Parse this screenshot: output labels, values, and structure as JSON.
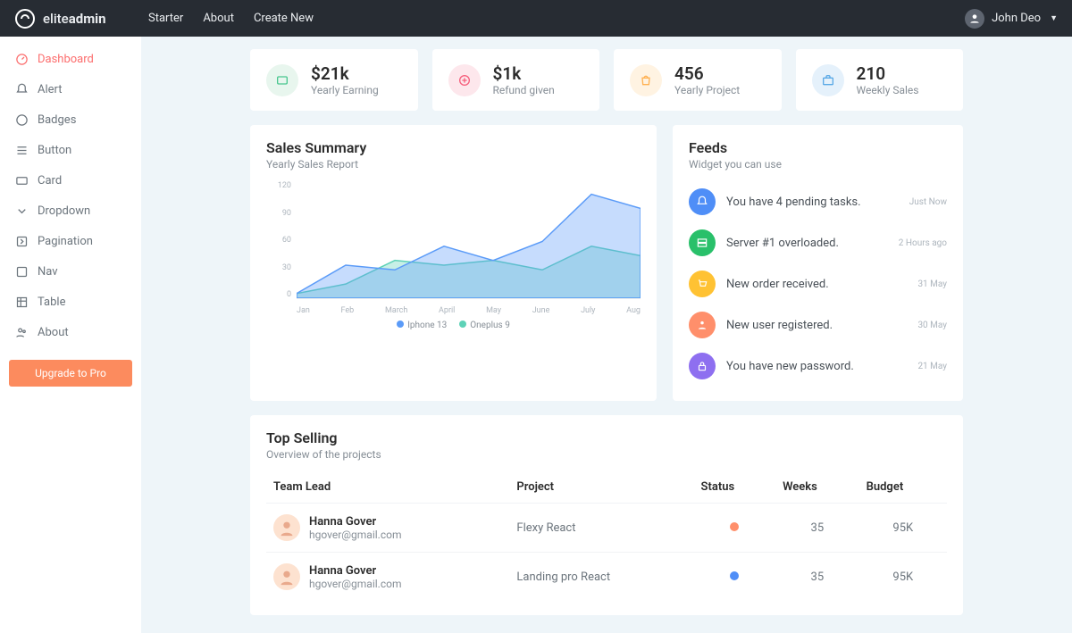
{
  "brand": {
    "pre": "elite",
    "bold": "admin"
  },
  "topnav": [
    "Starter",
    "About",
    "Create New"
  ],
  "user": {
    "name": "John Deo"
  },
  "sidebar": [
    {
      "label": "Dashboard",
      "icon": "dashboard-icon",
      "active": true
    },
    {
      "label": "Alert",
      "icon": "bell-icon"
    },
    {
      "label": "Badges",
      "icon": "tag-icon"
    },
    {
      "label": "Button",
      "icon": "list-icon"
    },
    {
      "label": "Card",
      "icon": "card-icon"
    },
    {
      "label": "Dropdown",
      "icon": "dropdown-icon"
    },
    {
      "label": "Pagination",
      "icon": "pagination-icon"
    },
    {
      "label": "Nav",
      "icon": "nav-icon"
    },
    {
      "label": "Table",
      "icon": "table-icon"
    },
    {
      "label": "About",
      "icon": "users-icon"
    }
  ],
  "upgrade_label": "Upgrade to Pro",
  "stats": [
    {
      "value": "$21k",
      "label": "Yearly Earning",
      "bg": "#e8f6ee",
      "fg": "#48c78e",
      "icon": "wallet-icon"
    },
    {
      "value": "$1k",
      "label": "Refund given",
      "bg": "#fde7ec",
      "fg": "#f65f7c",
      "icon": "refund-icon"
    },
    {
      "value": "456",
      "label": "Yearly Project",
      "bg": "#fff3e2",
      "fg": "#ffb152",
      "icon": "bag-icon"
    },
    {
      "value": "210",
      "label": "Weekly Sales",
      "bg": "#e5f1fb",
      "fg": "#5aa9e6",
      "icon": "briefcase-icon"
    }
  ],
  "sales": {
    "title": "Sales Summary",
    "subtitle": "Yearly Sales Report",
    "legend": [
      {
        "name": "Iphone 13",
        "color": "#5b9bf8"
      },
      {
        "name": "Oneplus 9",
        "color": "#5ed2b7"
      }
    ]
  },
  "chart_data": {
    "type": "area",
    "categories": [
      "Jan",
      "Feb",
      "March",
      "April",
      "May",
      "June",
      "July",
      "Aug"
    ],
    "ylabel": "",
    "y_ticks": [
      120,
      90,
      60,
      30,
      0
    ],
    "ylim": [
      0,
      120
    ],
    "series": [
      {
        "name": "Iphone 13",
        "color": "#5b9bf8",
        "values": [
          5,
          35,
          30,
          55,
          40,
          60,
          110,
          95
        ]
      },
      {
        "name": "Oneplus 9",
        "color": "#5ed2b7",
        "values": [
          5,
          15,
          40,
          35,
          40,
          30,
          55,
          45
        ]
      }
    ]
  },
  "feeds": {
    "title": "Feeds",
    "subtitle": "Widget you can use",
    "items": [
      {
        "text": "You have 4 pending tasks.",
        "time": "Just Now",
        "bg": "#4f8ef7",
        "icon": "bell-icon"
      },
      {
        "text": "Server #1 overloaded.",
        "time": "2 Hours ago",
        "bg": "#29c06a",
        "icon": "server-icon"
      },
      {
        "text": "New order received.",
        "time": "31 May",
        "bg": "#ffc233",
        "icon": "cart-icon"
      },
      {
        "text": "New user registered.",
        "time": "30 May",
        "bg": "#ff8f6b",
        "icon": "user-icon"
      },
      {
        "text": "You have new password.",
        "time": "21 May",
        "bg": "#8e6ff0",
        "icon": "lock-icon"
      }
    ]
  },
  "top_selling": {
    "title": "Top Selling",
    "subtitle": "Overview of the projects",
    "headers": {
      "lead": "Team Lead",
      "project": "Project",
      "status": "Status",
      "weeks": "Weeks",
      "budget": "Budget"
    },
    "rows": [
      {
        "name": "Hanna Gover",
        "email": "hgover@gmail.com",
        "project": "Flexy React",
        "status_color": "#ff8f6b",
        "weeks": "35",
        "budget": "95K"
      },
      {
        "name": "Hanna Gover",
        "email": "hgover@gmail.com",
        "project": "Landing pro React",
        "status_color": "#4f8ef7",
        "weeks": "35",
        "budget": "95K"
      }
    ]
  }
}
